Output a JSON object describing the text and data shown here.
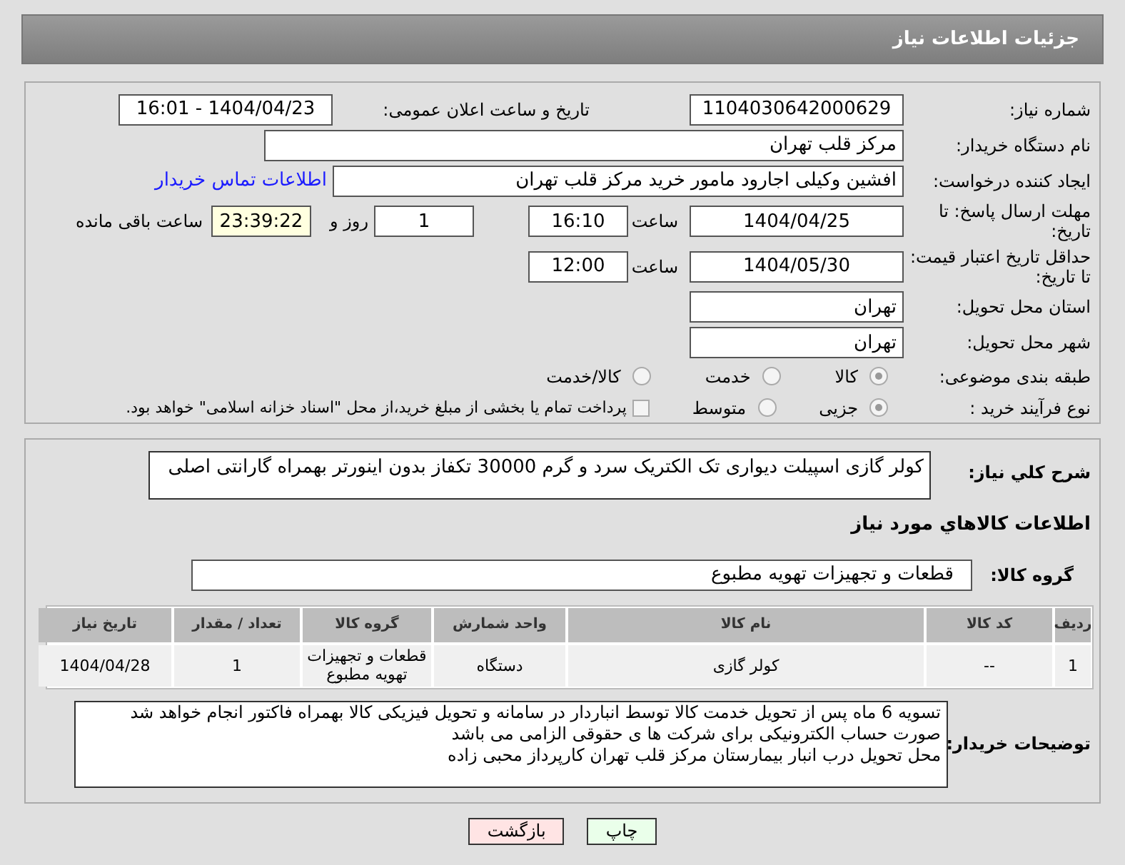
{
  "header": {
    "title": "جزئیات اطلاعات نیاز"
  },
  "need_number": {
    "label": "شماره نیاز:",
    "value": "1104030642000629"
  },
  "announce": {
    "label": "تاریخ و ساعت اعلان عمومی:",
    "value": "1404/04/23 - 16:01"
  },
  "buyer_org": {
    "label": "نام دستگاه خریدار:",
    "value": "مرکز قلب تهران"
  },
  "creator": {
    "label": "ایجاد کننده درخواست:",
    "value": "افشین وکیلی اجارود مامور خرید مرکز قلب تهران",
    "link": "اطلاعات تماس خریدار"
  },
  "response_deadline": {
    "label": "مهلت ارسال پاسخ: تا تاریخ:",
    "date": "1404/04/25",
    "time_label": "ساعت",
    "time": "16:10",
    "days": "1",
    "days_label": "روز و",
    "remaining": "23:39:22",
    "remaining_label": "ساعت باقی مانده"
  },
  "price_validity": {
    "label": "حداقل تاریخ اعتبار قیمت: تا تاریخ:",
    "date": "1404/05/30",
    "time_label": "ساعت",
    "time": "12:00"
  },
  "province": {
    "label": "استان محل تحویل:",
    "value": "تهران"
  },
  "city": {
    "label": "شهر محل تحویل:",
    "value": "تهران"
  },
  "category": {
    "label": "طبقه بندی موضوعی:",
    "options": [
      {
        "label": "کالا",
        "selected": true
      },
      {
        "label": "خدمت",
        "selected": false
      },
      {
        "label": "کالا/خدمت",
        "selected": false
      }
    ]
  },
  "purchase_process": {
    "label": "نوع فرآیند خرید :",
    "options": [
      {
        "label": "جزیی",
        "selected": true
      },
      {
        "label": "متوسط",
        "selected": false
      }
    ],
    "payment_note": {
      "label": "پرداخت تمام یا بخشی از مبلغ خرید،از محل \"اسناد خزانه اسلامی\" خواهد بود.",
      "checked": false
    }
  },
  "description": {
    "label": "شرح کلي نياز:",
    "value": "کولر گازی اسپیلت دیواری تک الکتریک سرد و گرم 30000 تکفاز بدون اینورتر بهمراه گارانتی اصلی"
  },
  "goods_title": "اطلاعات کالاهاي مورد نياز",
  "goods_group": {
    "label": "گروه کالا:",
    "value": "قطعات و تجهیزات تهویه مطبوع"
  },
  "table": {
    "columns": [
      "ردیف",
      "کد کالا",
      "نام کالا",
      "واحد شمارش",
      "گروه کالا",
      "تعداد / مقدار",
      "تاریخ نیاز"
    ],
    "rows": [
      [
        "1",
        "--",
        "کولر گازی",
        "دستگاه",
        "قطعات و تجهیزات تهویه مطبوع",
        "1",
        "1404/04/28"
      ]
    ]
  },
  "buyer_notes": {
    "label": "توضیحات خریدار:",
    "lines": [
      "تسویه 6 ماه پس از تحویل خدمت کالا توسط انباردار در سامانه و تحویل فیزیکی کالا بهمراه فاکتور انجام خواهد شد",
      "صورت حساب الکترونیکی برای شرکت ها ی حقوقی الزامی می باشد",
      "محل تحویل درب انبار بیمارستان مرکز قلب تهران کارپرداز محبی زاده"
    ]
  },
  "buttons": [
    {
      "label": "چاپ",
      "kind": "print"
    },
    {
      "label": "بازگشت",
      "kind": "back"
    }
  ]
}
